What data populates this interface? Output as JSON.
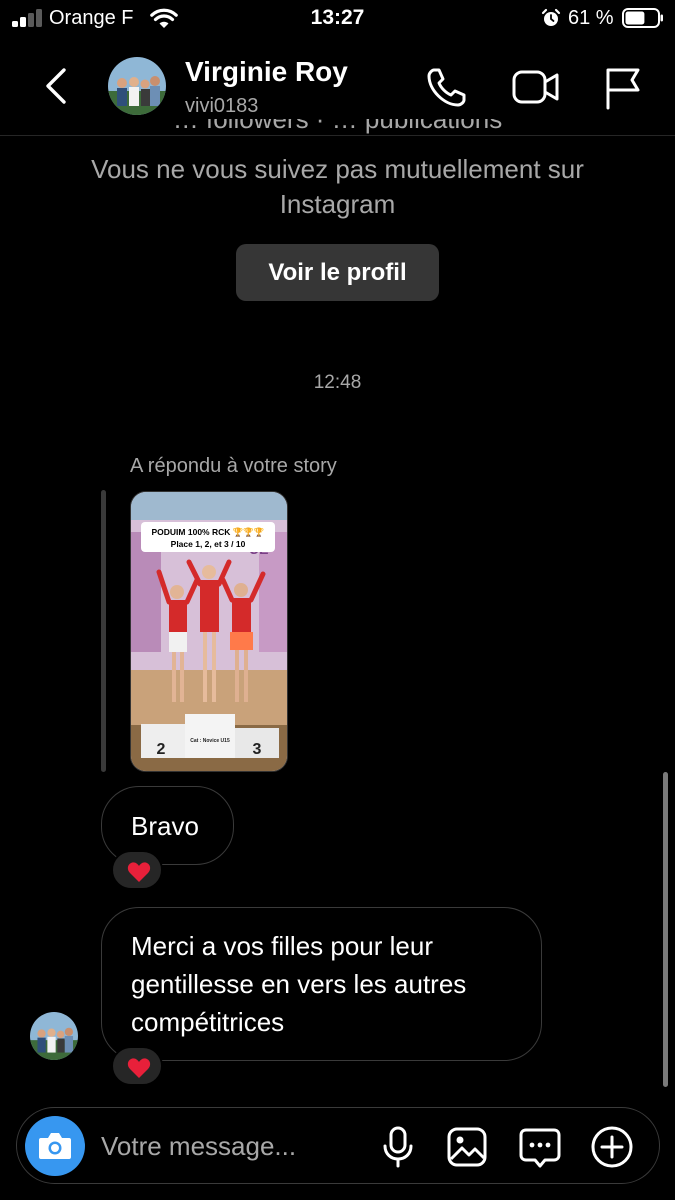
{
  "status": {
    "carrier": "Orange F",
    "time": "13:27",
    "battery_percent": "61 %",
    "battery_level": 0.61
  },
  "header": {
    "name": "Virginie Roy",
    "username": "vivi0183",
    "icons": [
      "back-icon",
      "phone-icon",
      "video-camera-icon",
      "flag-icon"
    ]
  },
  "profile_info": {
    "followers_line": "… followers · … publications",
    "not_following": "Vous ne vous suivez pas mutuellement sur Instagram",
    "view_profile_label": "Voir le profil"
  },
  "conversation": {
    "timestamp": "12:48",
    "story_reply_label": "A répondu à votre story",
    "story": {
      "banner_line1": "PODUIM 100% RCK 🏆🏆🏆",
      "banner_line2": "Place 1, 2, et 3 / 10",
      "podium_left": "2",
      "podium_center": "Cat : Novice U15",
      "podium_right": "3"
    },
    "messages": [
      {
        "text": "Bravo",
        "reaction": "❤️"
      },
      {
        "text": "Merci a vos filles pour leur gentillesse en vers les autres compétitrices",
        "reaction": "❤️"
      }
    ]
  },
  "composer": {
    "placeholder": "Votre message...",
    "icons": [
      "camera-icon",
      "microphone-icon",
      "gallery-icon",
      "sticker-icon",
      "plus-icon"
    ]
  },
  "colors": {
    "background": "#000000",
    "secondary_text": "#a8a8a8",
    "button_bg": "#363636",
    "camera_blue": "#3797f0",
    "reaction_bg": "#262626",
    "heart": "#e8203a"
  }
}
